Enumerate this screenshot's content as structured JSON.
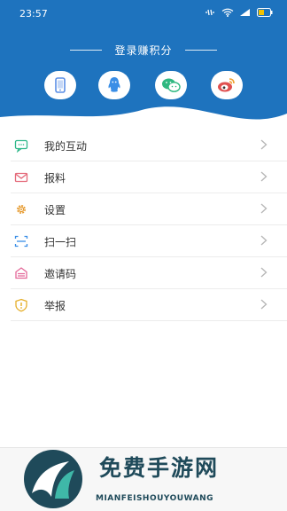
{
  "status_bar": {
    "time": "23:57"
  },
  "login": {
    "title": "登录赚积分"
  },
  "social": [
    {
      "name": "phone-login-icon"
    },
    {
      "name": "qq-icon"
    },
    {
      "name": "wechat-icon"
    },
    {
      "name": "weibo-icon"
    }
  ],
  "menu": {
    "items": [
      {
        "label": "我的互动",
        "icon": "chat-icon"
      },
      {
        "label": "报料",
        "icon": "mail-icon"
      },
      {
        "label": "设置",
        "icon": "gear-icon"
      },
      {
        "label": "扫一扫",
        "icon": "scan-icon"
      },
      {
        "label": "邀请码",
        "icon": "invite-code-icon"
      },
      {
        "label": "举报",
        "icon": "report-icon"
      }
    ]
  },
  "watermark": {
    "title": "免费手游网",
    "subtitle": "MIANFEISHOUYOUWANG"
  },
  "colors": {
    "header_blue": "#1E73BE",
    "accent_green": "#2fb88a",
    "accent_red": "#e05050",
    "accent_orange": "#e69a2e"
  }
}
